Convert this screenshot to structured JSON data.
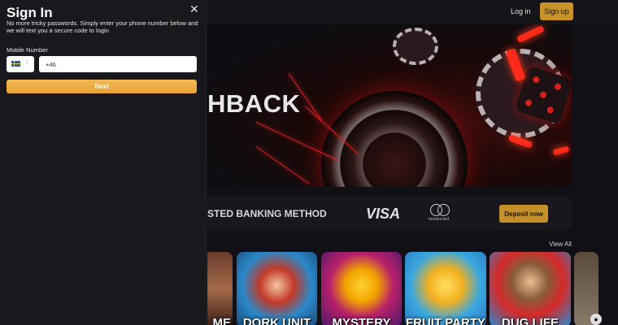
{
  "header": {
    "login_label": "Log in",
    "signup_label": "Sign up"
  },
  "hero": {
    "partial_text": "HBACK"
  },
  "banking": {
    "partial_text": "STED BANKING METHOD",
    "visa_label": "VISA",
    "mastercard_label": "mastercard",
    "deposit_label": "Deposit now"
  },
  "games": {
    "view_all_label": "View All",
    "tiles": [
      {
        "title": "ME"
      },
      {
        "title": "DORK UNIT"
      },
      {
        "title": "MYSTERY"
      },
      {
        "title": "FRUIT PARTY"
      },
      {
        "title": "DUG LIFE"
      }
    ]
  },
  "signin": {
    "title": "Sign In",
    "description": "No more tricky passwords. Simply enter your phone number below and we will text you a secure code to login",
    "mobile_label": "Mobile Number",
    "phone_value": "+46",
    "country_flag": "sweden-flag",
    "next_label": "Next",
    "close_icon": "close-icon"
  },
  "colors": {
    "accent": "#c79227",
    "next_button": "#f0b14a",
    "panel_bg": "#18181d",
    "page_bg": "#101016"
  }
}
